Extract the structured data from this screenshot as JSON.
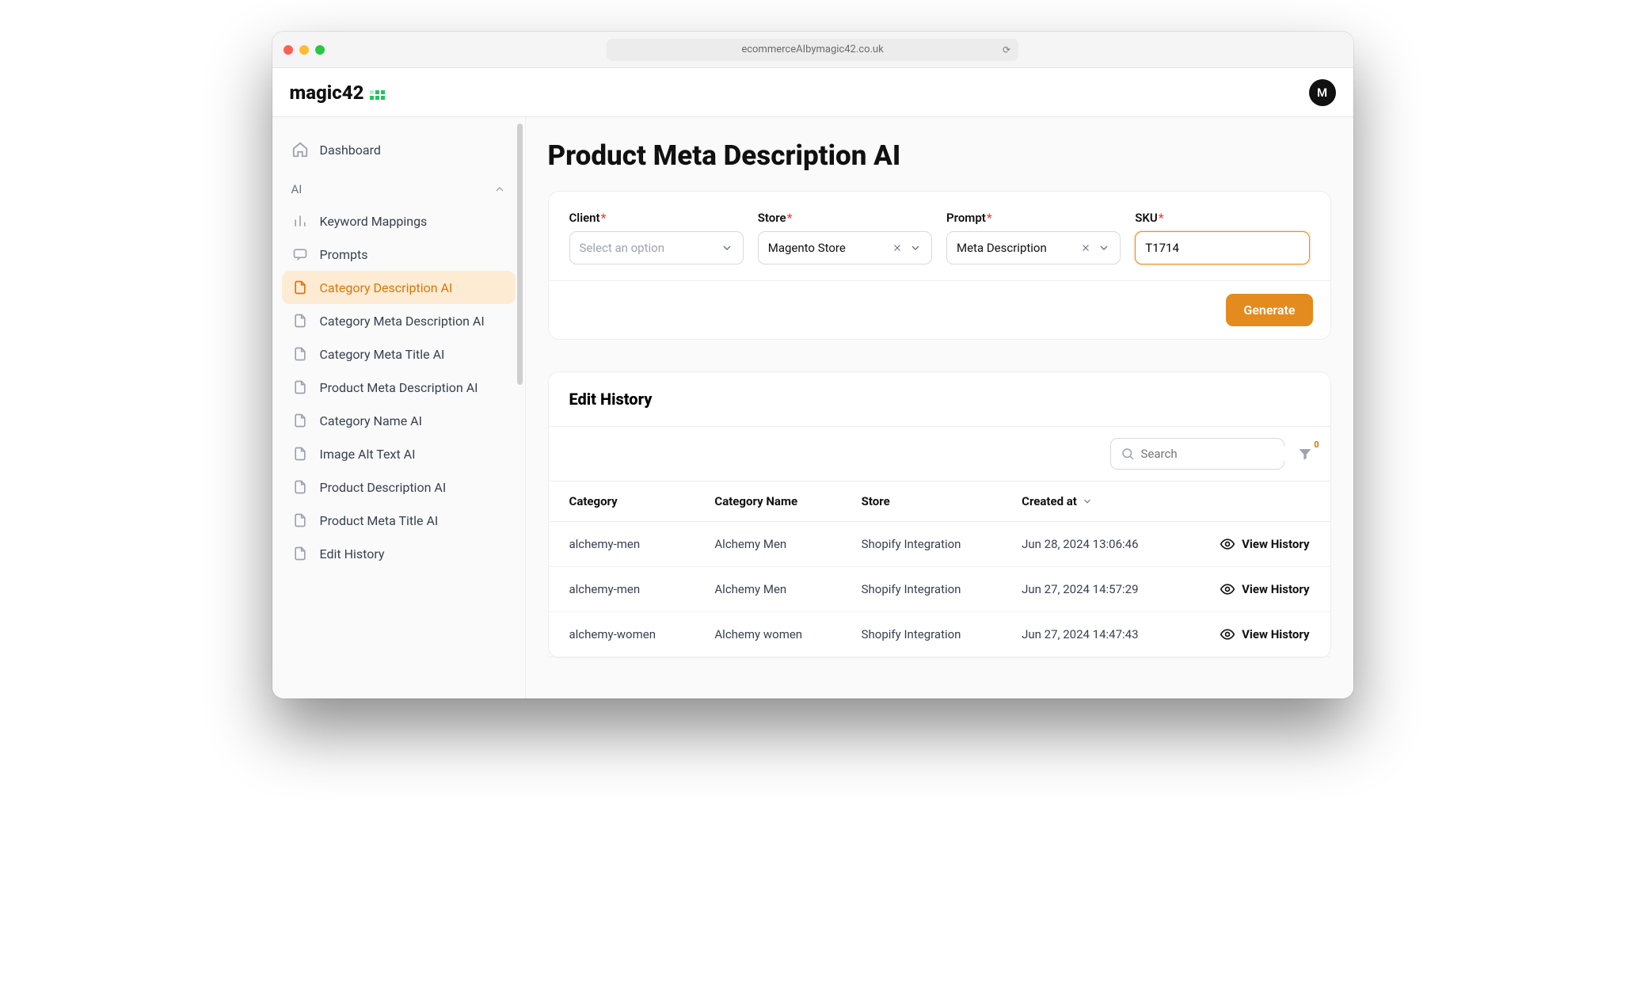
{
  "browser": {
    "url": "ecommerceAIbymagic42.co.uk"
  },
  "header": {
    "logo_text": "magic42",
    "avatar_initial": "M"
  },
  "sidebar": {
    "dashboard": "Dashboard",
    "section_label": "AI",
    "items": [
      {
        "label": "Keyword Mappings",
        "icon": "bars"
      },
      {
        "label": "Prompts",
        "icon": "chat"
      },
      {
        "label": "Category Description AI",
        "icon": "doc",
        "active": true
      },
      {
        "label": "Category Meta Description AI",
        "icon": "doc"
      },
      {
        "label": "Category Meta Title AI",
        "icon": "doc"
      },
      {
        "label": "Product Meta Description AI",
        "icon": "doc"
      },
      {
        "label": "Category Name AI",
        "icon": "doc"
      },
      {
        "label": "Image Alt Text AI",
        "icon": "doc"
      },
      {
        "label": "Product Description AI",
        "icon": "doc"
      },
      {
        "label": "Product Meta Title AI",
        "icon": "doc"
      },
      {
        "label": "Edit History",
        "icon": "doc"
      }
    ]
  },
  "page": {
    "title": "Product Meta Description AI",
    "form": {
      "client": {
        "label": "Client",
        "placeholder": "Select an option"
      },
      "store": {
        "label": "Store",
        "value": "Magento Store"
      },
      "prompt": {
        "label": "Prompt",
        "value": "Meta Description"
      },
      "sku": {
        "label": "SKU",
        "value": "T1714"
      }
    },
    "generate_label": "Generate"
  },
  "history": {
    "title": "Edit History",
    "search_placeholder": "Search",
    "filter_count": "0",
    "columns": [
      "Category",
      "Category Name",
      "Store",
      "Created at",
      ""
    ],
    "view_label": "View History",
    "rows": [
      {
        "category": "alchemy-men",
        "name": "Alchemy Men",
        "store": "Shopify Integration",
        "created": "Jun 28, 2024 13:06:46"
      },
      {
        "category": "alchemy-men",
        "name": "Alchemy Men",
        "store": "Shopify Integration",
        "created": "Jun 27, 2024 14:57:29"
      },
      {
        "category": "alchemy-women",
        "name": "Alchemy women",
        "store": "Shopify Integration",
        "created": "Jun 27, 2024 14:47:43"
      }
    ]
  }
}
